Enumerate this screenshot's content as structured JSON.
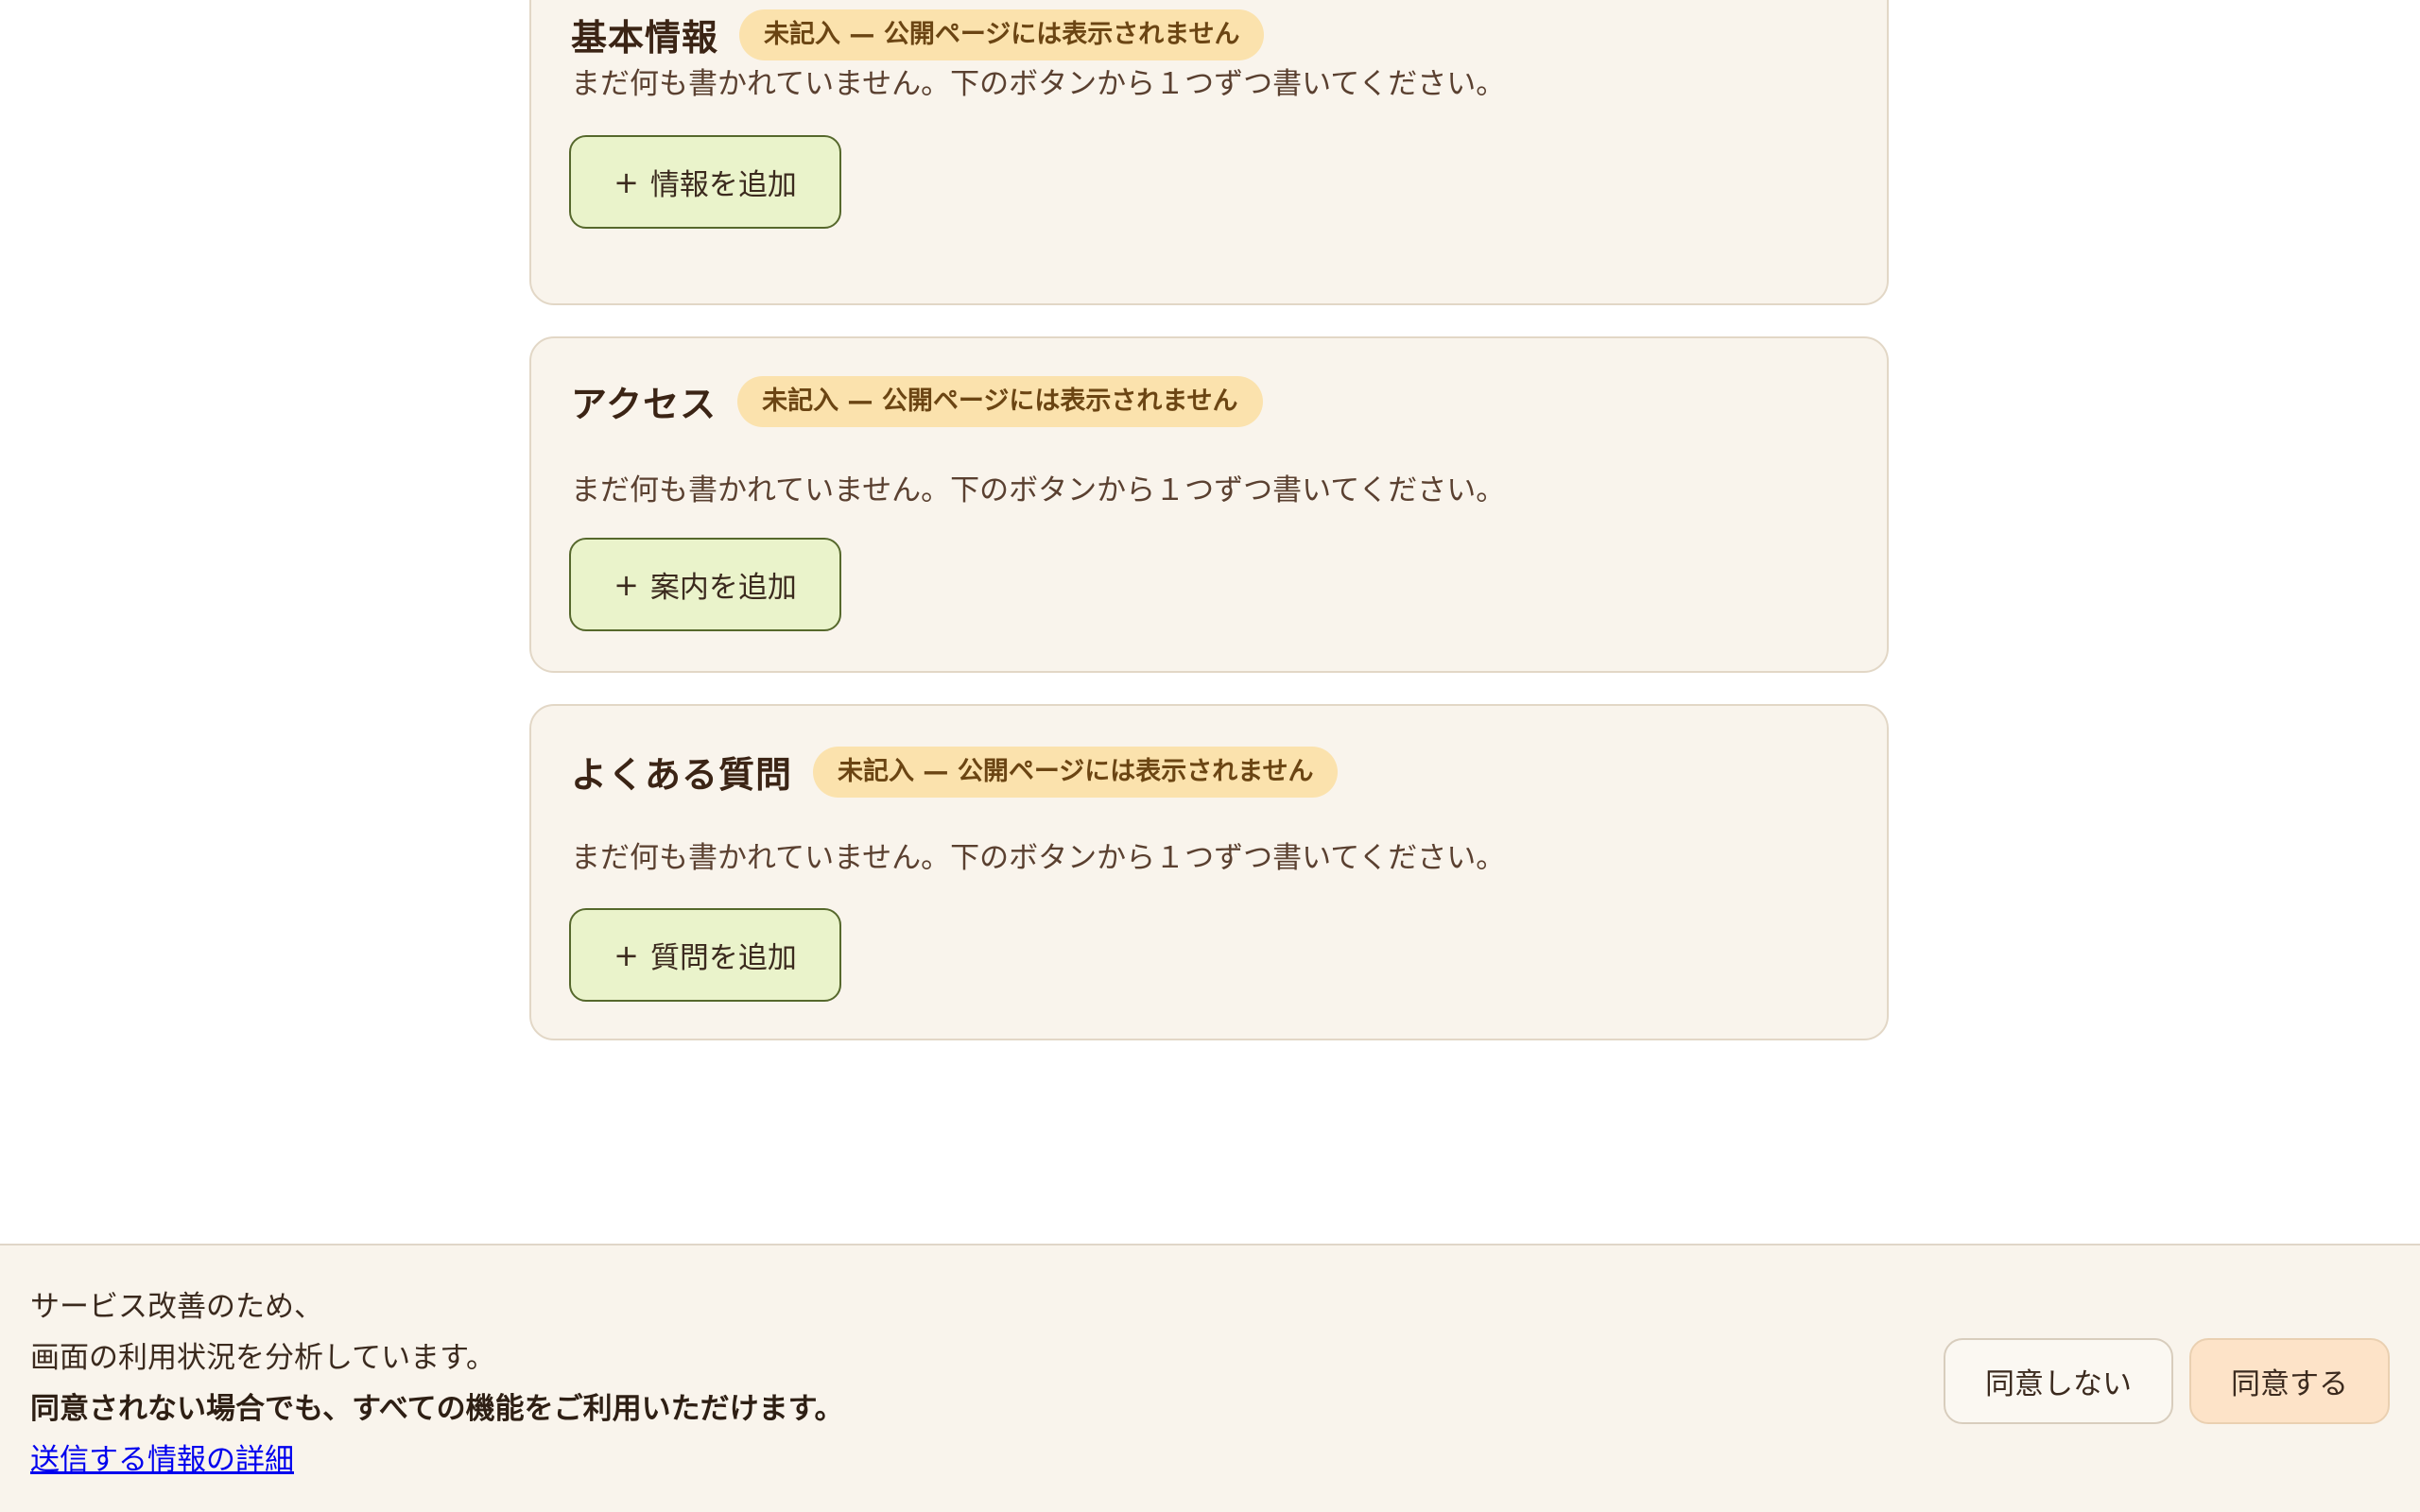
{
  "sections": [
    {
      "title": "基本情報",
      "status": "未記入 — 公開ページには表示されません",
      "description": "まだ何も書かれていません。下のボタンから１つずつ書いてください。",
      "add_label": "情報を追加"
    },
    {
      "title": "アクセス",
      "status": "未記入 — 公開ページには表示されません",
      "description": "まだ何も書かれていません。下のボタンから１つずつ書いてください。",
      "add_label": "案内を追加"
    },
    {
      "title": "よくある質問",
      "status": "未記入 — 公開ページには表示されません",
      "description": "まだ何も書かれていません。下のボタンから１つずつ書いてください。",
      "add_label": "質問を追加"
    }
  ],
  "icons": {
    "add": "plus-icon"
  },
  "plus_glyph": "+",
  "consent": {
    "line1": "サービス改善のため、",
    "line2": "画面の利用状況を分析しています。",
    "line3": "同意されない場合でも、すべての機能をご利用いただけます。",
    "details_link": "送信する情報の詳細",
    "decline_label": "同意しない",
    "accept_label": "同意する"
  },
  "colors": {
    "card_background": "#f9f4ec",
    "badge_background": "#fbe2ad",
    "add_button_background": "#eaf3cb",
    "accept_button_background": "#fde3c8"
  }
}
